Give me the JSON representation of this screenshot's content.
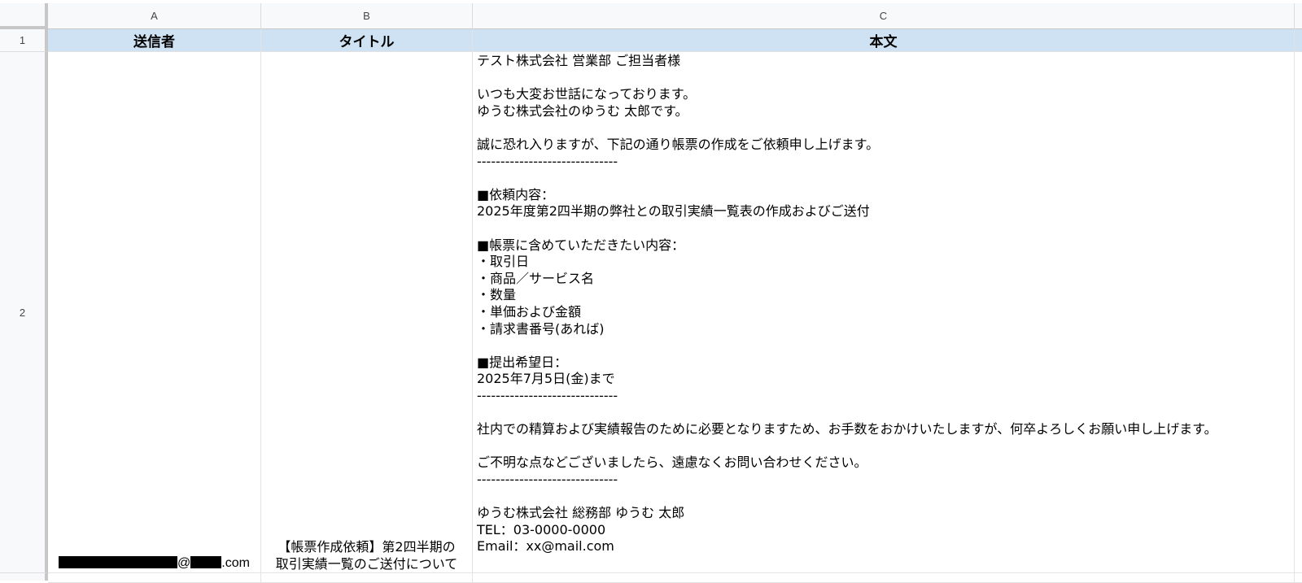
{
  "sheet": {
    "columns": [
      "A",
      "B",
      "C"
    ],
    "rows": [
      "1",
      "2"
    ],
    "headers": {
      "sender": "送信者",
      "title": "タイトル",
      "body": "本文"
    },
    "row2": {
      "sender_at": "@",
      "sender_domain_suffix": ".com",
      "title_lines": [
        "【帳票作成依頼】第2四半期の",
        "取引実績一覧のご送付について"
      ],
      "body_lines": [
        "テスト株式会社 営業部 ご担当者様",
        "",
        "いつも大変お世話になっております。",
        "ゆうむ株式会社のゆうむ 太郎です。",
        "",
        "誠に恐れ入りますが、下記の通り帳票の作成をご依頼申し上げます。",
        "------------------------------",
        "",
        "■依頼内容：",
        "2025年度第2四半期の弊社との取引実績一覧表の作成およびご送付",
        "",
        "■帳票に含めていただきたい内容：",
        "・取引日",
        "・商品／サービス名",
        "・数量",
        "・単価および金額",
        "・請求書番号(あれば)",
        "",
        "■提出希望日：",
        "2025年7月5日(金)まで",
        "------------------------------",
        "",
        "社内での精算および実績報告のために必要となりますため、お手数をおかけいたしますが、何卒よろしくお願い申し上げます。",
        "",
        "ご不明な点などございましたら、遠慮なくお問い合わせください。",
        "------------------------------",
        "",
        "ゆうむ株式会社 総務部 ゆうむ 太郎",
        "TEL：03-0000-0000",
        "Email：xx@mail.com"
      ]
    }
  },
  "colors": {
    "header_fill": "#cfe2f3",
    "grid_line": "#e3e3e3",
    "chrome_bg": "#f8f9fa",
    "redaction": "#000000"
  }
}
